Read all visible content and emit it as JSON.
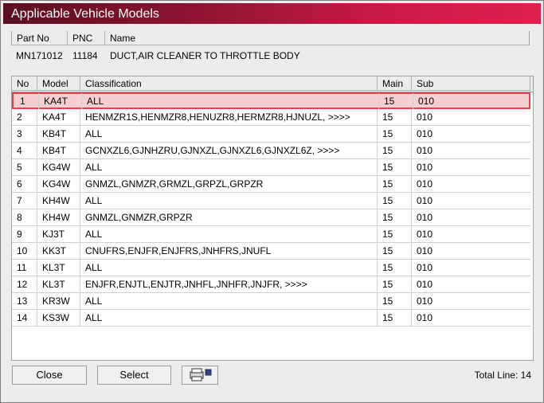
{
  "window": {
    "title": "Applicable Vehicle Models"
  },
  "part_table": {
    "headers": {
      "part_no": "Part No",
      "pnc": "PNC",
      "name": "Name"
    },
    "row": {
      "part_no": "MN171012",
      "pnc": "11184",
      "name": "DUCT,AIR CLEANER TO THROTTLE BODY"
    }
  },
  "models_table": {
    "headers": {
      "no": "No",
      "model": "Model",
      "classification": "Classification",
      "main": "Main",
      "sub": "Sub"
    },
    "rows": [
      {
        "no": "1",
        "model": "KA4T",
        "classification": "ALL",
        "main": "15",
        "sub": "010"
      },
      {
        "no": "2",
        "model": "KA4T",
        "classification": "HENMZR1S,HENMZR8,HENUZR8,HERMZR8,HJNUZL,  >>>>",
        "main": "15",
        "sub": "010"
      },
      {
        "no": "3",
        "model": "KB4T",
        "classification": "ALL",
        "main": "15",
        "sub": "010"
      },
      {
        "no": "4",
        "model": "KB4T",
        "classification": "GCNXZL6,GJNHZRU,GJNXZL,GJNXZL6,GJNXZL6Z,  >>>>",
        "main": "15",
        "sub": "010"
      },
      {
        "no": "5",
        "model": "KG4W",
        "classification": "ALL",
        "main": "15",
        "sub": "010"
      },
      {
        "no": "6",
        "model": "KG4W",
        "classification": "GNMZL,GNMZR,GRMZL,GRPZL,GRPZR",
        "main": "15",
        "sub": "010"
      },
      {
        "no": "7",
        "model": "KH4W",
        "classification": "ALL",
        "main": "15",
        "sub": "010"
      },
      {
        "no": "8",
        "model": "KH4W",
        "classification": "GNMZL,GNMZR,GRPZR",
        "main": "15",
        "sub": "010"
      },
      {
        "no": "9",
        "model": "KJ3T",
        "classification": "ALL",
        "main": "15",
        "sub": "010"
      },
      {
        "no": "10",
        "model": "KK3T",
        "classification": "CNUFRS,ENJFR,ENJFRS,JNHFRS,JNUFL",
        "main": "15",
        "sub": "010"
      },
      {
        "no": "11",
        "model": "KL3T",
        "classification": "ALL",
        "main": "15",
        "sub": "010"
      },
      {
        "no": "12",
        "model": "KL3T",
        "classification": "ENJFR,ENJTL,ENJTR,JNHFL,JNHFR,JNJFR,  >>>>",
        "main": "15",
        "sub": "010"
      },
      {
        "no": "13",
        "model": "KR3W",
        "classification": "ALL",
        "main": "15",
        "sub": "010"
      },
      {
        "no": "14",
        "model": "KS3W",
        "classification": "ALL",
        "main": "15",
        "sub": "010"
      }
    ]
  },
  "buttons": {
    "close": "Close",
    "select": "Select",
    "print_icon": "printer-icon"
  },
  "footer": {
    "total_line": "Total Line: 14"
  },
  "colors": {
    "title_start": "#5a0f20",
    "title_end": "#e0204f",
    "selection_border": "#e3414d",
    "selection_fill": "#f6d0d0"
  }
}
